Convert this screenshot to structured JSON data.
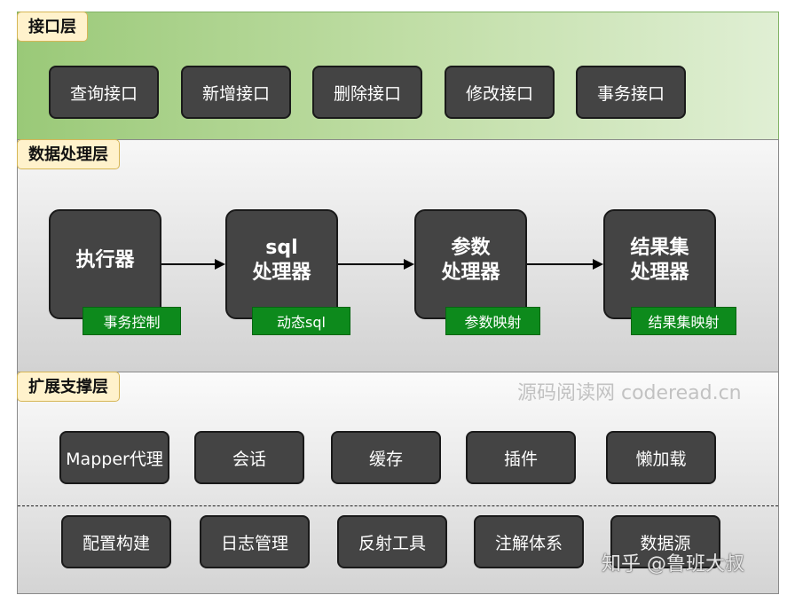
{
  "layers": {
    "interface": {
      "label": "接口层",
      "items": [
        "查询接口",
        "新增接口",
        "删除接口",
        "修改接口",
        "事务接口"
      ]
    },
    "data_processing": {
      "label": "数据处理层",
      "processors": [
        {
          "line1": "执行器",
          "line2": "",
          "tag": "事务控制"
        },
        {
          "line1": "sql",
          "line2": "处理器",
          "tag": "动态sql"
        },
        {
          "line1": "参数",
          "line2": "处理器",
          "tag": "参数映射"
        },
        {
          "line1": "结果集",
          "line2": "处理器",
          "tag": "结果集映射"
        }
      ]
    },
    "extension": {
      "label": "扩展支撑层",
      "row1": [
        "Mapper代理",
        "会话",
        "缓存",
        "插件",
        "懒加载"
      ],
      "row2": [
        "配置构建",
        "日志管理",
        "反射工具",
        "注解体系",
        "数据源"
      ]
    }
  },
  "watermarks": {
    "site": "源码阅读网 coderead.cn",
    "zhihu": "知乎 @鲁班大叔"
  },
  "colors": {
    "box": "#444444",
    "tag": "#0d8a1c",
    "label_bg": "#fff2cc",
    "interface_bg": "#9ac978"
  }
}
